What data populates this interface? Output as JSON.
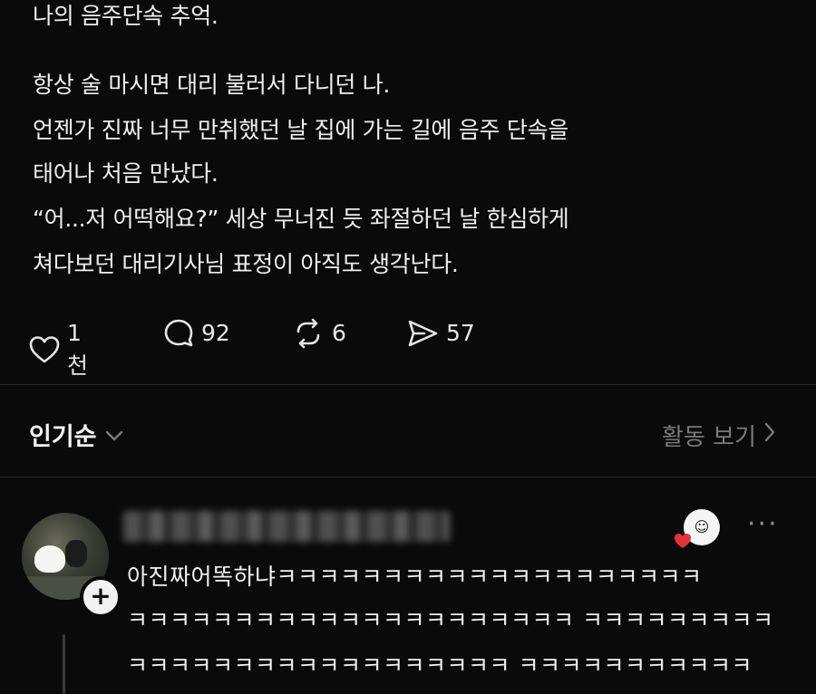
{
  "post": {
    "lines": [
      "나의 음주단속 추억.",
      "항상 술 마시면 대리 불러서 다니던 나.",
      "언젠가 진짜 너무 만취했던 날 집에 가는 길에 음주 단속을",
      "태어나 처음 만났다.",
      "“어...저 어떡해요?” 세상 무너진 듯 좌절하던 날 한심하게",
      "쳐다보던 대리기사님 표정이 아직도 생각난다."
    ],
    "actions": {
      "likes": "1천",
      "comments": "92",
      "reposts": "6",
      "shares": "57"
    }
  },
  "sort": {
    "label": "인기순",
    "activity_label": "활동 보기"
  },
  "reply": {
    "sticker_icon": "face-sticker-icon",
    "more_label": "···",
    "lines": [
      "아진짜어똑하냐ㅋㅋㅋㅋㅋㅋㅋㅋㅋㅋㅋㅋㅋㅋㅋㅋㅋㅋㅋㅋ",
      "ㅋㅋㅋㅋㅋㅋㅋㅋㅋㅋㅋㅋㅋㅋㅋㅋㅋㅋㅋㅋㅋ ㅋㅋㅋㅋㅋㅋㅋㅋㅋ",
      "ㅋㅋㅋㅋㅋㅋㅋㅋㅋㅋㅋㅋㅋㅋㅋㅋㅋㅋ ㅋㅋㅋㅋㅋㅋㅋㅋㅋㅋㅋ"
    ]
  },
  "colors": {
    "background": "#0a0a0a",
    "text": "#f0f0f0",
    "muted": "#7a7a7a",
    "heart_badge": "#e5303a"
  }
}
